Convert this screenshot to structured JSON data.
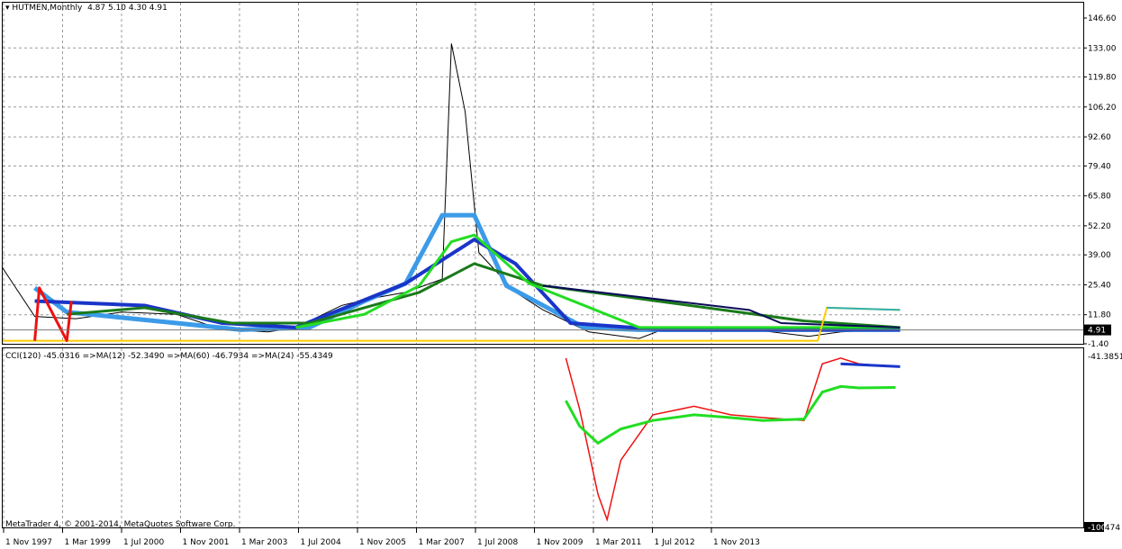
{
  "header": {
    "symbol": "HUTMEN,Monthly",
    "ohlc": "4.87 5.10 4.30 4.91"
  },
  "indicator_legend": "CCI(120) -45.0316  =>MA(12) -52.3490  =>MA(60) -46.7934  =>MA(24) -55.4349",
  "copyright": "MetaTrader 4, © 2001-2014, MetaQuotes Software Corp.",
  "price_axis_labels": [
    "146.60",
    "133.00",
    "119.80",
    "106.20",
    "92.60",
    "79.40",
    "65.80",
    "52.20",
    "39.00",
    "25.40",
    "11.80",
    "-1.40"
  ],
  "current_price": "4.91",
  "cci_axis_top": "-41.3851",
  "cci_axis_bottom": "-100.474",
  "cci_axis_bottom_short": "-100",
  "time_labels": [
    "1 Nov 1997",
    "1 Mar 1999",
    "1 Jul 2000",
    "1 Nov 2001",
    "1 Mar 2003",
    "1 Jul 2004",
    "1 Nov 2005",
    "1 Mar 2007",
    "1 Jul 2008",
    "1 Nov 2009",
    "1 Mar 2011",
    "1 Jul 2012",
    "1 Nov 2013"
  ],
  "colors": {
    "background": "#ffffff",
    "grid": "#9a9a9a",
    "candles": "#000000",
    "ma_fast": "#3c9be8",
    "ma_mid": "#1a35c8",
    "ma_slow": "#0a0a5a",
    "ma_green_light": "#22dd22",
    "ma_green_dark": "#1a7a1a",
    "yellow": "#ffcc00",
    "red": "#ee1111",
    "teal": "#30b0b0",
    "cci_line": "#ee1111",
    "cci_ma": "#22dd22",
    "cci_ma2": "#1a35c8"
  },
  "chart_data": [
    {
      "type": "line",
      "title": "HUTMEN,Monthly",
      "ylim": [
        -1.4,
        146.6
      ],
      "x": [
        "1997-11",
        "1998-06",
        "1999-03",
        "2000-01",
        "2001-01",
        "2001-11",
        "2002-09",
        "2003-03",
        "2004-01",
        "2004-07",
        "2005-03",
        "2005-11",
        "2006-01",
        "2006-04",
        "2006-07",
        "2007-03",
        "2007-09",
        "2008-07",
        "2009-06",
        "2009-11",
        "2011-03",
        "2012-07",
        "2013-02",
        "2013-11",
        "2014-03"
      ],
      "series": [
        {
          "name": "Close",
          "values": [
            33,
            11,
            10,
            13,
            12,
            5,
            4,
            6,
            16,
            19,
            22,
            28,
            135,
            104,
            40,
            22,
            14,
            4,
            1,
            5,
            6,
            2,
            4,
            5,
            4.91
          ]
        }
      ],
      "grid": true
    },
    {
      "type": "line",
      "title": "CCI(120)",
      "ylim": [
        -100.474,
        -41.3851
      ],
      "x": [
        "2008-02",
        "2008-05",
        "2008-09",
        "2008-11",
        "2009-02",
        "2009-09",
        "2010-06",
        "2011-02",
        "2011-09",
        "2012-06",
        "2012-10",
        "2013-02",
        "2013-06",
        "2014-02"
      ],
      "series": [
        {
          "name": "CCI(120)",
          "values": [
            -42,
            -60,
            -90,
            -99,
            -78,
            -62,
            -59,
            -62,
            -63,
            -64,
            -44,
            -42,
            -44,
            -45.03
          ]
        },
        {
          "name": "MA(12)",
          "values": [
            -57,
            -66,
            -72,
            -70,
            -67,
            -64,
            -62,
            -63,
            -64,
            -63.5,
            -54,
            -52,
            -52.5,
            -52.35
          ]
        }
      ]
    }
  ]
}
